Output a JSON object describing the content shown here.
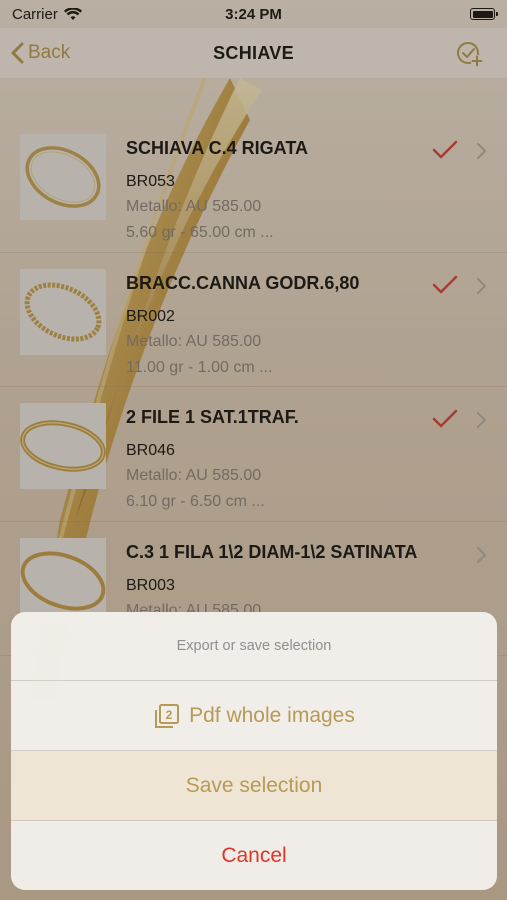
{
  "status_bar": {
    "carrier": "Carrier",
    "time": "3:24 PM"
  },
  "navbar": {
    "back_label": "Back",
    "title": "SCHIAVE"
  },
  "items": [
    {
      "title": "SCHIAVA C.4 RIGATA",
      "code": "BR053",
      "metal": "Metallo: AU 585.00",
      "dims": "5.60 gr - 65.00 cm ...",
      "selected": true
    },
    {
      "title": "BRACC.CANNA GODR.6,80",
      "code": "BR002",
      "metal": "Metallo: AU 585.00",
      "dims": "11.00 gr - 1.00 cm ...",
      "selected": true
    },
    {
      "title": "2 FILE 1 SAT.1TRAF.",
      "code": "BR046",
      "metal": "Metallo: AU 585.00",
      "dims": "6.10 gr - 6.50 cm ...",
      "selected": true
    },
    {
      "title": "C.3 1 FILA 1\\2 DIAM-1\\2 SATINATA",
      "code": "BR003",
      "metal": "Metallo: AU 585.00",
      "dims": "",
      "selected": false
    }
  ],
  "action_sheet": {
    "title": "Export or save selection",
    "pdf_label": "Pdf whole images",
    "save_label": "Save selection",
    "cancel_label": "Cancel"
  },
  "colors": {
    "accent": "#b79a56",
    "check": "#d9413b",
    "cancel": "#e0362a"
  }
}
